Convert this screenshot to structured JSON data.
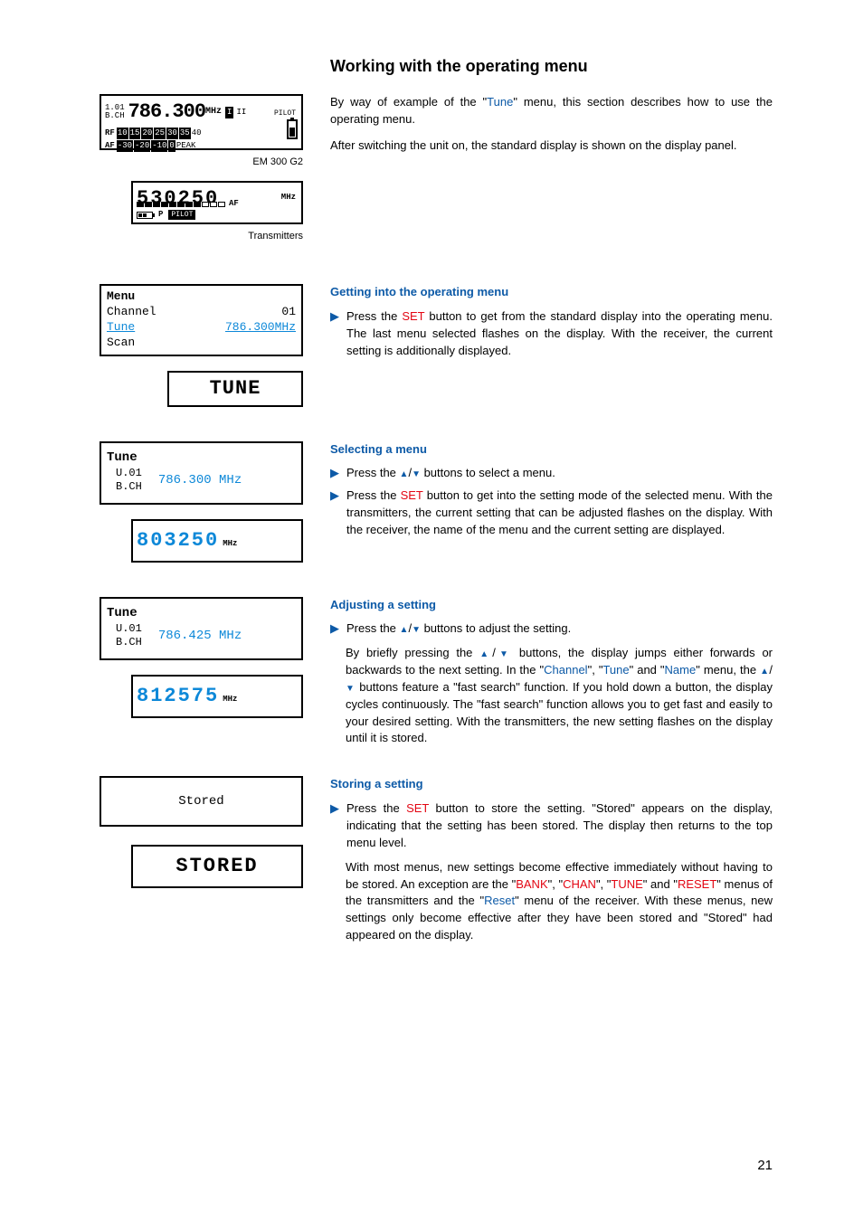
{
  "title": "Working with the operating menu",
  "intro": {
    "p1": "By way of example of the \"Tune\" menu, this section describes how to use the operating menu.",
    "p1_pre": "By way of example of the \"",
    "p1_kw": "Tune",
    "p1_post": "\" menu, this section describes how to use the operating menu.",
    "p2": "After switching the unit on, the standard display is shown on the display panel."
  },
  "lcd_main": {
    "bank": "1.01",
    "bch_label": "B.CH",
    "freq": "786.300",
    "mhz": "MHz",
    "ant": [
      "I",
      "II"
    ],
    "pilot": "PILOT",
    "rf_label": "RF",
    "rf_scale": [
      "10",
      "15",
      "20",
      "25",
      "30",
      "35",
      "40"
    ],
    "af_label": "AF",
    "af_scale": [
      "-30",
      "-20",
      "-10",
      "0",
      "PEAK"
    ]
  },
  "caption_receiver": "EM 300 G2",
  "lcd_tx": {
    "seg": "530250",
    "unit": "MHz",
    "af": "AF",
    "p": "P",
    "pilot": "PILOT"
  },
  "caption_tx": "Transmitters",
  "sec1": {
    "title": "Getting into the operating menu",
    "step_pre": "Press the ",
    "step_kw": "SET",
    "step_post": " button to get from the standard display into the operating menu. The last menu selected flashes on the display. With the receiver, the current setting is additionally displayed."
  },
  "lcd_menu": {
    "title": "Menu",
    "r1_l": "Channel",
    "r1_v": "01",
    "r2_l": "Tune",
    "r2_v": "786.300MHz",
    "r3_l": "Scan"
  },
  "lcd_tune_word": "TUNE",
  "sec2": {
    "title": "Selecting a menu",
    "s1_pre": "Press the ",
    "s1_post": " buttons to select a menu.",
    "s2_pre": "Press the ",
    "s2_kw": "SET",
    "s2_post": " button to get into the setting mode of the selected menu. With the transmitters, the current setting that can be adjusted flashes on the display. With the receiver, the name of the menu and the current setting are displayed."
  },
  "lcd_tune1": {
    "title": "Tune",
    "l1": "U.01",
    "l2": "B.CH",
    "val": "786.300 MHz"
  },
  "lcd_seg_blue1": {
    "seg": "803250",
    "unit": "MHz"
  },
  "sec3": {
    "title": "Adjusting a setting",
    "s1_pre": "Press the ",
    "s1_post": " buttons to adjust the setting.",
    "body_pre": "By briefly pressing the ",
    "body_mid1": " buttons, the display jumps either forwards or backwards to the next setting. In the \"",
    "kw_channel": "Channel",
    "body_mid2": "\", \"",
    "kw_tune": "Tune",
    "body_mid3": "\" and \"",
    "kw_name": "Name",
    "body_mid4": "\" menu, the ",
    "body_post": " buttons feature a \"fast search\" function. If you hold down a button, the display cycles continuously. The \"fast search\" function allows you to get fast and easily to your desired setting. With the transmitters, the new setting flashes on the display until it is stored."
  },
  "lcd_tune2": {
    "title": "Tune",
    "l1": "U.01",
    "l2": "B.CH",
    "val": "786.425 MHz"
  },
  "lcd_seg_blue2": {
    "seg": "812575",
    "unit": "MHz"
  },
  "sec4": {
    "title": "Storing a setting",
    "s1_pre": "Press the ",
    "s1_kw": "SET",
    "s1_post": " button to store the setting. \"Stored\" appears on the display, indicating that the setting has been stored. The display then returns to the top menu level.",
    "body_pre": "With most menus, new settings become effective immediately without having to be stored. An exception are the \"",
    "kw_bank": "BANK",
    "m1": "\", \"",
    "kw_chan": "CHAN",
    "m2": "\", \"",
    "kw_tune": "TUNE",
    "m3": "\" and \"",
    "kw_reset1": "RESET",
    "m4": "\" menus of the transmitters and the \"",
    "kw_reset2": "Reset",
    "body_post": "\" menu of the receiver. With these menus, new settings only become effective after they have been stored and \"Stored\" had appeared on the display."
  },
  "lcd_stored": "Stored",
  "lcd_stored_seg": "STORED",
  "page_number": "21"
}
